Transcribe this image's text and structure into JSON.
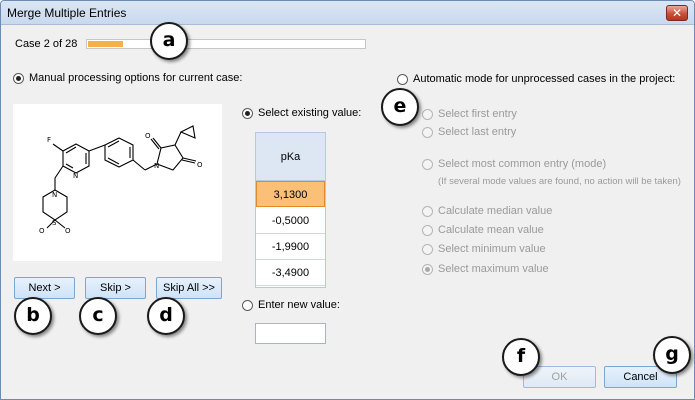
{
  "window": {
    "title": "Merge Multiple Entries",
    "close_glyph": "✕"
  },
  "progress": {
    "case_text": "Case 2 of 28",
    "current": 2,
    "total": 28,
    "fill_color": "#f5b04a"
  },
  "manual": {
    "label": "Manual processing options for current case:",
    "checked": true,
    "select_existing": {
      "label": "Select existing value:",
      "checked": true
    },
    "table": {
      "header": "pKa",
      "values": [
        "3,1300",
        "-0,5000",
        "-1,9900",
        "-3,4900"
      ],
      "selected_index": 0
    },
    "enter_new": {
      "label": "Enter new value:",
      "checked": false,
      "value": ""
    }
  },
  "buttons": {
    "next": "Next >",
    "skip": "Skip >",
    "skip_all": "Skip All >>",
    "ok": "OK",
    "cancel": "Cancel"
  },
  "auto": {
    "label": "Automatic mode for unprocessed cases in the project:",
    "checked": false,
    "options": [
      {
        "id": "first",
        "label": "Select first entry",
        "checked": false
      },
      {
        "id": "last",
        "label": "Select last entry",
        "checked": false
      },
      {
        "id": "mode",
        "label": "Select most common entry (mode)",
        "checked": false
      },
      {
        "id": "median",
        "label": "Calculate median value",
        "checked": false
      },
      {
        "id": "mean",
        "label": "Calculate mean value",
        "checked": false
      },
      {
        "id": "min",
        "label": "Select minimum value",
        "checked": false
      },
      {
        "id": "max",
        "label": "Select maximum value",
        "checked": true
      }
    ],
    "mode_note": "(If several mode values are found, no action will be taken)"
  },
  "callouts": {
    "a": "a",
    "b": "b",
    "c": "c",
    "d": "d",
    "e": "e",
    "f": "f",
    "g": "g"
  },
  "structure": {
    "atoms": {
      "F": "F",
      "N1": "N",
      "N2": "N",
      "N3": "N",
      "S": "S",
      "O1": "O",
      "O2": "O",
      "O3": "O",
      "O4": "O"
    }
  }
}
